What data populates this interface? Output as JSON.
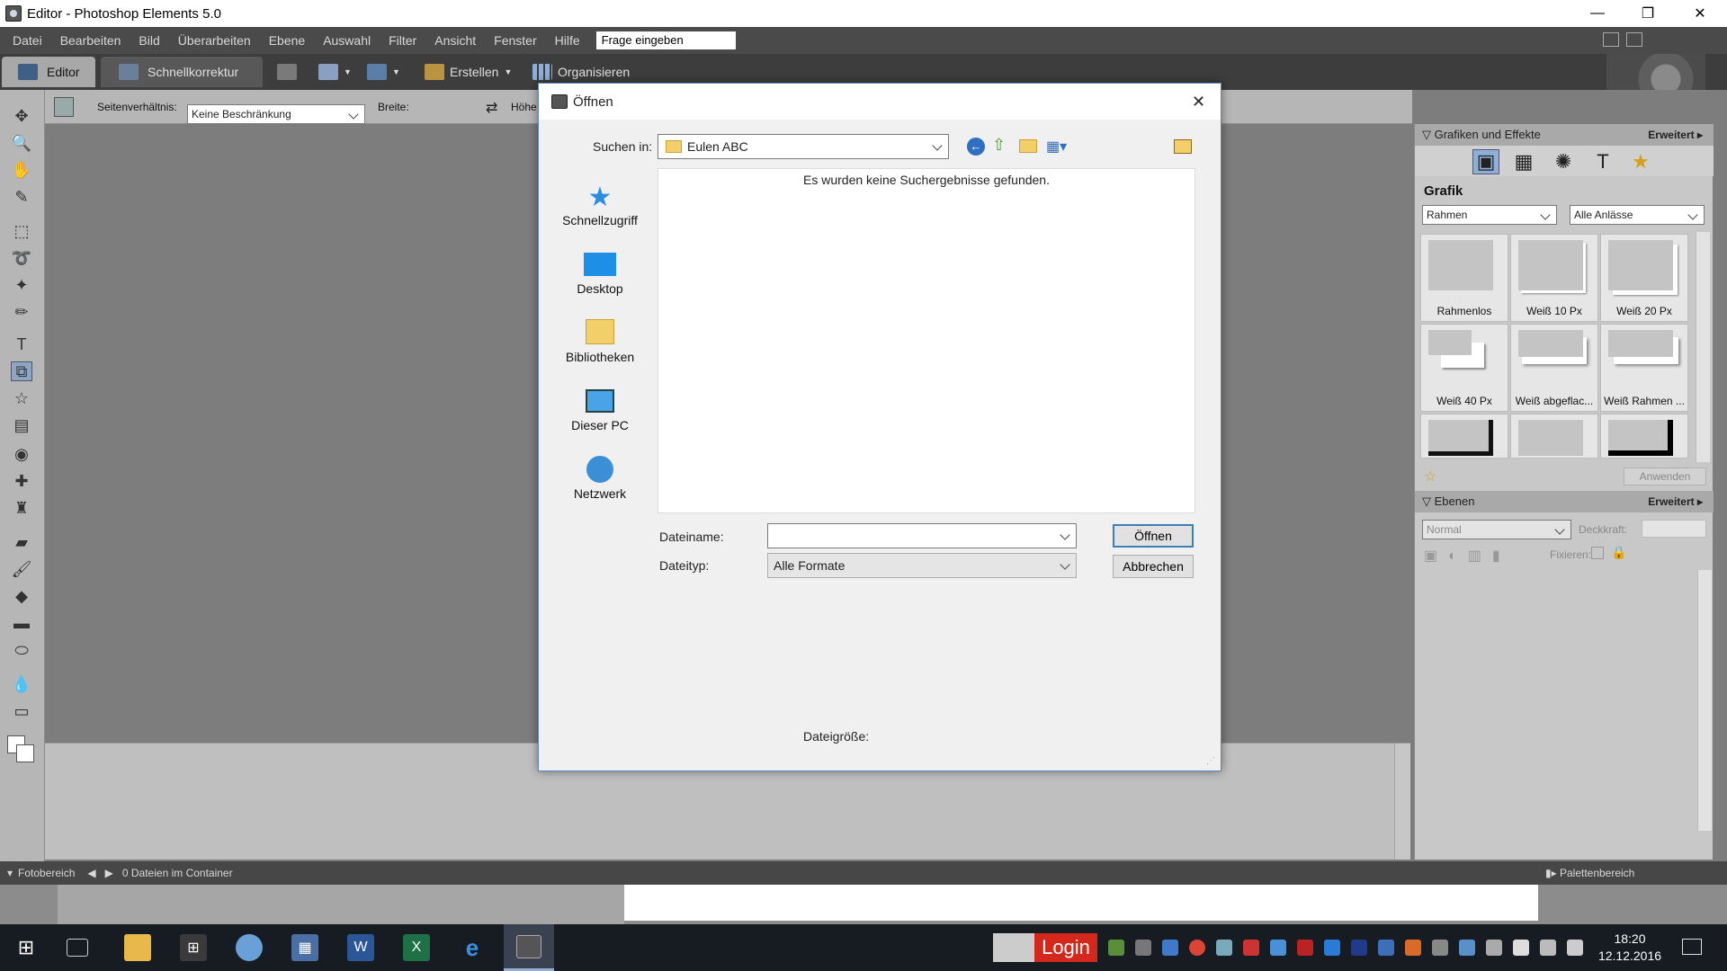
{
  "window": {
    "title": "Editor - Photoshop Elements 5.0",
    "controls": {
      "minimize": "—",
      "restore": "❐",
      "close": "✕"
    }
  },
  "menu": {
    "items": [
      "Datei",
      "Bearbeiten",
      "Bild",
      "Überarbeiten",
      "Ebene",
      "Auswahl",
      "Filter",
      "Ansicht",
      "Fenster",
      "Hilfe"
    ],
    "ask_field": "Frage eingeben"
  },
  "shortcuts": {
    "editor_tab": "Editor",
    "quick_fix_tab": "Schnellkorrektur",
    "create": "Erstellen",
    "organize": "Organisieren"
  },
  "options_bar": {
    "aspect_label": "Seitenverhältnis:",
    "aspect_value": "Keine Beschränkung",
    "width_label": "Breite:",
    "height_label": "Höhe"
  },
  "dialog": {
    "title": "Öffnen",
    "look_in_label": "Suchen in:",
    "look_in_value": "Eulen ABC",
    "empty_message": "Es wurden keine Suchergebnisse gefunden.",
    "places": [
      "Schnellzugriff",
      "Desktop",
      "Bibliotheken",
      "Dieser PC",
      "Netzwerk"
    ],
    "filename_label": "Dateiname:",
    "filename_value": "",
    "filetype_label": "Dateityp:",
    "filetype_value": "Alle Formate",
    "open_button": "Öffnen",
    "cancel_button": "Abbrechen",
    "filesize_label": "Dateigröße:"
  },
  "palette": {
    "effects_header": "Grafiken und Effekte",
    "more_label": "Erweitert",
    "section_title": "Grafik",
    "category_value": "Rahmen",
    "occasion_value": "Alle Anlässe",
    "thumbnails": [
      "Rahmenlos",
      "Weiß 10 Px",
      "Weiß 20 Px",
      "Weiß 40 Px",
      "Weiß abgeflac...",
      "Weiß Rahmen ...",
      "",
      "",
      ""
    ],
    "apply_button": "Anwenden",
    "layers_header": "Ebenen",
    "blend_mode": "Normal",
    "opacity_label": "Deckkraft:",
    "lock_label": "Fixieren:"
  },
  "statusbar": {
    "photobin_label": "Fotobereich",
    "container_text": "0 Dateien im Container",
    "palette_label": "Palettenbereich"
  },
  "taskbar": {
    "login_label": "Login",
    "time": "18:20",
    "date": "12.12.2016"
  }
}
